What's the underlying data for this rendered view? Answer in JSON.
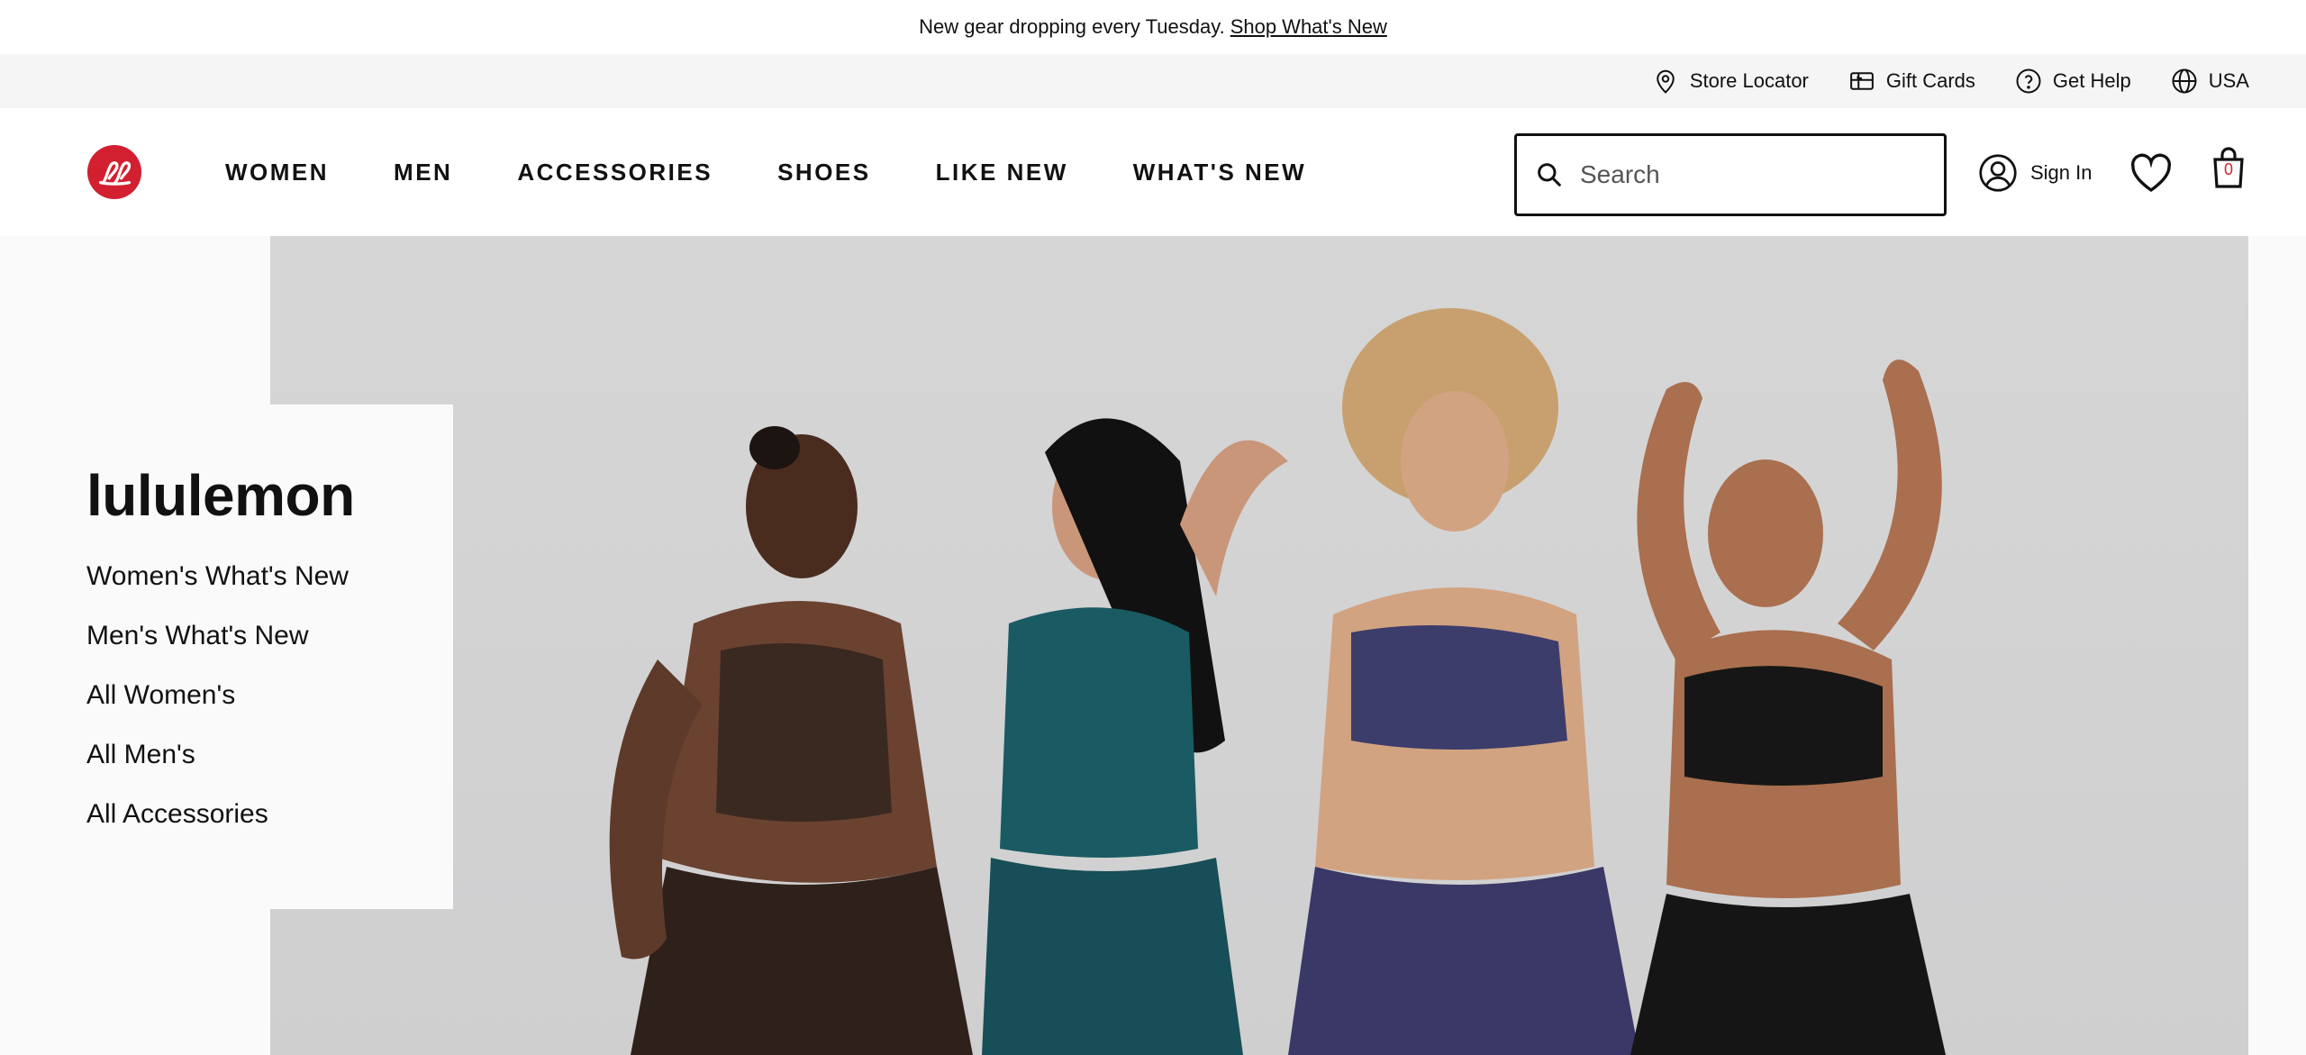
{
  "promo": {
    "text": "New gear dropping every Tuesday.",
    "link": "Shop What's New"
  },
  "utility": {
    "items": [
      {
        "label": "Store Locator",
        "icon": "location-pin-icon"
      },
      {
        "label": "Gift Cards",
        "icon": "gift-card-icon"
      },
      {
        "label": "Get Help",
        "icon": "help-circle-icon"
      },
      {
        "label": "USA",
        "icon": "globe-icon"
      }
    ]
  },
  "header": {
    "logo_icon": "lululemon-logo",
    "brand_color": "#d22030",
    "nav": [
      "WOMEN",
      "MEN",
      "ACCESSORIES",
      "SHOES",
      "LIKE NEW",
      "WHAT'S NEW"
    ],
    "search_placeholder": "Search",
    "signin_label": "Sign In",
    "bag_count": "0"
  },
  "hero": {
    "brand": "lululemon",
    "links": [
      "Women's What's New",
      "Men's What's New",
      "All Women's",
      "All Men's",
      "All Accessories"
    ]
  }
}
